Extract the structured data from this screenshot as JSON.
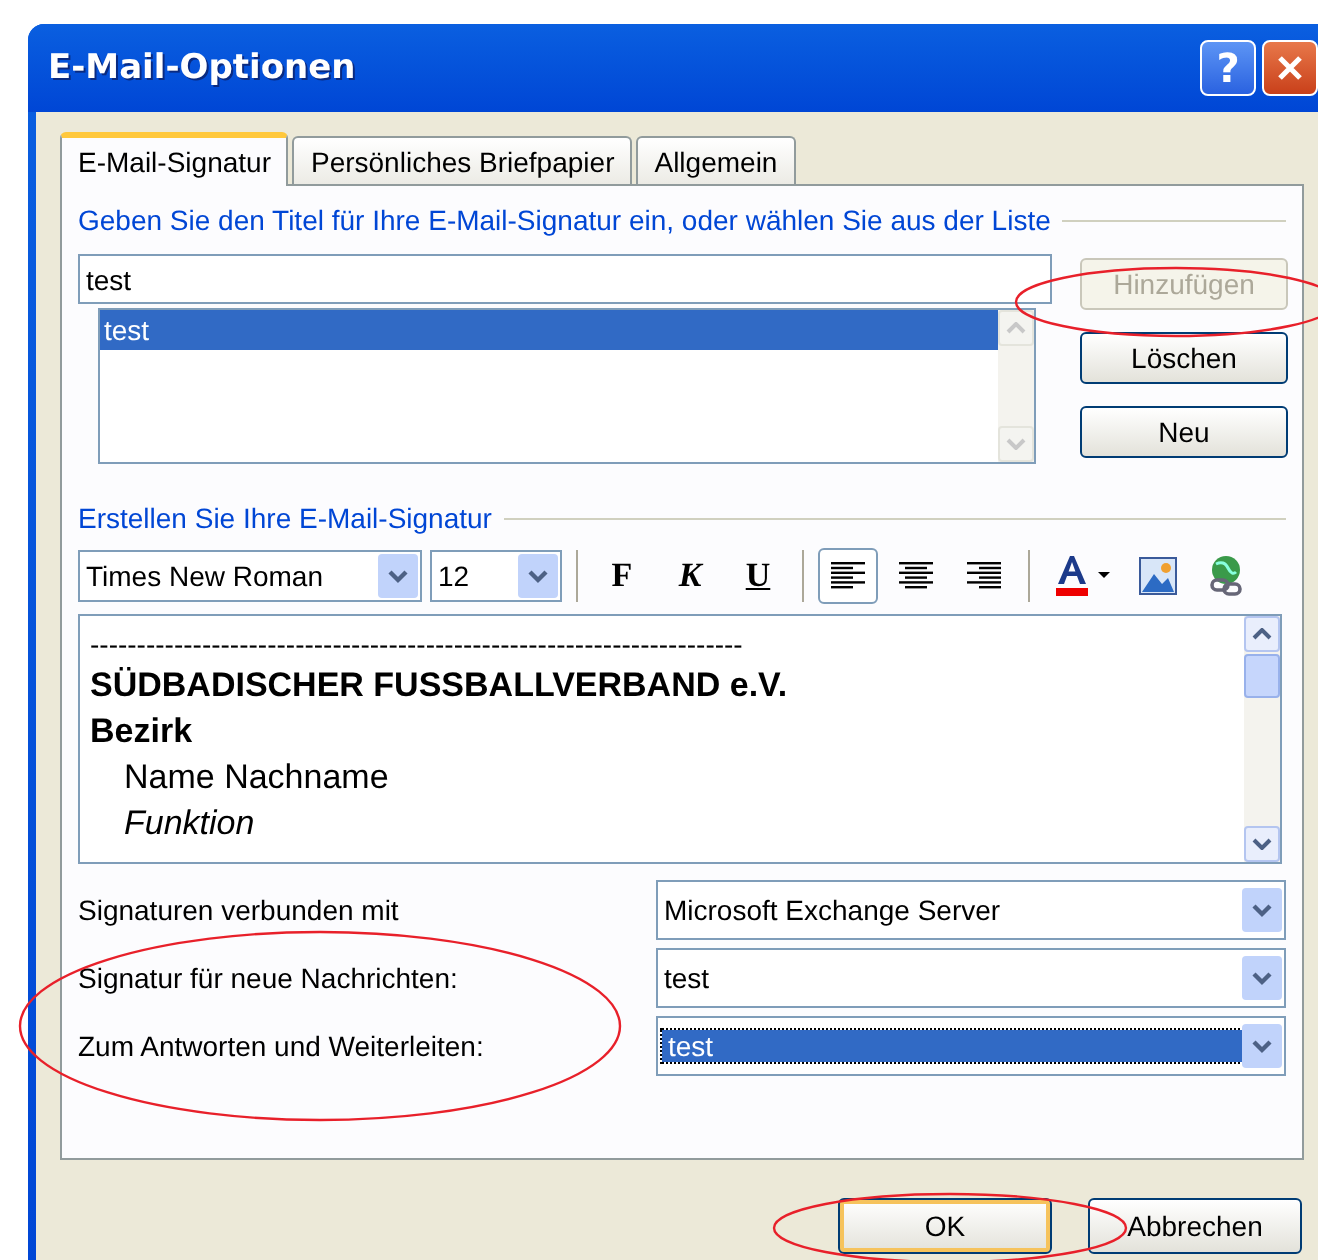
{
  "window": {
    "title": "E-Mail-Optionen",
    "help_button": "?"
  },
  "tabs": [
    {
      "label": "E-Mail-Signatur",
      "selected": true
    },
    {
      "label": "Persönliches Briefpapier",
      "selected": false
    },
    {
      "label": "Allgemein",
      "selected": false
    }
  ],
  "title_section": {
    "label": "Geben Sie den Titel für Ihre E-Mail-Signatur ein, oder wählen Sie aus der Liste",
    "title_field": "test",
    "signatures": [
      {
        "name": "test",
        "selected": true
      }
    ],
    "buttons": [
      {
        "label": "Hinzufügen",
        "disabled": true
      },
      {
        "label": "Löschen",
        "disabled": false
      },
      {
        "label": "Neu",
        "disabled": false
      }
    ]
  },
  "editor_section": {
    "label": "Erstellen Sie Ihre E-Mail-Signatur",
    "font": "Times New Roman",
    "size": "12",
    "format_buttons": [
      "F",
      "K",
      "U"
    ],
    "alignments": [
      {
        "kind": "left",
        "selected": true
      },
      {
        "kind": "center",
        "selected": false
      },
      {
        "kind": "right",
        "selected": false
      }
    ],
    "lines": [
      {
        "kind": "plain",
        "text": "----------------------------------------------------------------------"
      },
      {
        "kind": "bold",
        "text": "SÜDBADISCHER FUSSBALLVERBAND e.V."
      },
      {
        "kind": "bold",
        "text": "Bezirk"
      },
      {
        "kind": "indent",
        "text": "Name Nachname"
      },
      {
        "kind": "indent-italic",
        "text": "Funktion"
      }
    ]
  },
  "settings": [
    {
      "label": "Signaturen verbunden mit",
      "value": "Microsoft Exchange Server",
      "selected": false
    },
    {
      "label": "Signatur für neue Nachrichten:",
      "value": "test",
      "selected": false
    },
    {
      "label": "Zum Antworten und Weiterleiten:",
      "value": "test",
      "selected": true
    }
  ],
  "footer_buttons": [
    {
      "label": "OK",
      "default": true
    },
    {
      "label": "Abbrechen",
      "default": false
    }
  ]
}
